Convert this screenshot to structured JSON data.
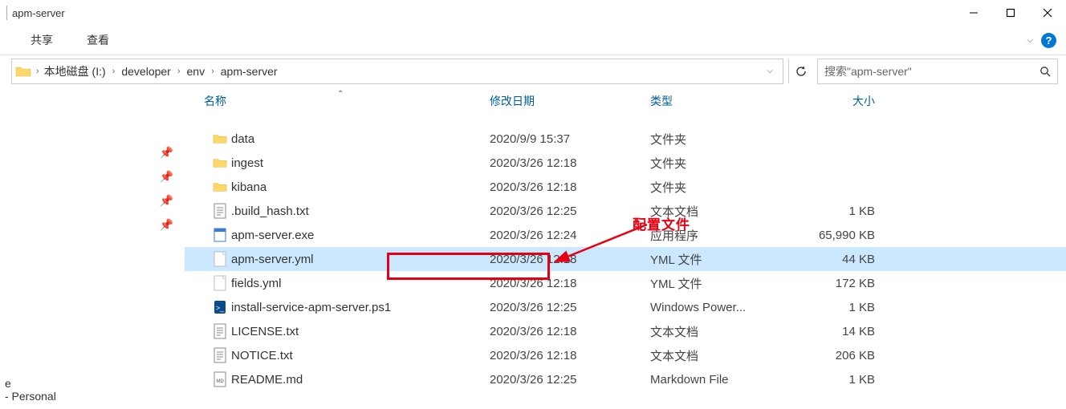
{
  "window": {
    "title": "apm-server"
  },
  "menubar": {
    "share": "共享",
    "view": "查看"
  },
  "breadcrumb": {
    "items": [
      "本地磁盘 (I:)",
      "developer",
      "env",
      "apm-server"
    ]
  },
  "search": {
    "placeholder": "搜索\"apm-server\""
  },
  "columns": {
    "name": "名称",
    "modified": "修改日期",
    "type": "类型",
    "size": "大小"
  },
  "files": [
    {
      "icon": "folder",
      "name": "data",
      "date": "2020/9/9 15:37",
      "type": "文件夹",
      "size": ""
    },
    {
      "icon": "folder",
      "name": "ingest",
      "date": "2020/3/26 12:18",
      "type": "文件夹",
      "size": ""
    },
    {
      "icon": "folder",
      "name": "kibana",
      "date": "2020/3/26 12:18",
      "type": "文件夹",
      "size": ""
    },
    {
      "icon": "txt",
      "name": ".build_hash.txt",
      "date": "2020/3/26 12:25",
      "type": "文本文档",
      "size": "1 KB"
    },
    {
      "icon": "exe",
      "name": "apm-server.exe",
      "date": "2020/3/26 12:24",
      "type": "应用程序",
      "size": "65,990 KB"
    },
    {
      "icon": "yml",
      "name": "apm-server.yml",
      "date": "2020/3/26 12:18",
      "type": "YML 文件",
      "size": "44 KB",
      "selected": true
    },
    {
      "icon": "yml",
      "name": "fields.yml",
      "date": "2020/3/26 12:18",
      "type": "YML 文件",
      "size": "172 KB"
    },
    {
      "icon": "ps1",
      "name": "install-service-apm-server.ps1",
      "date": "2020/3/26 12:25",
      "type": "Windows Power...",
      "size": "1 KB"
    },
    {
      "icon": "txt",
      "name": "LICENSE.txt",
      "date": "2020/3/26 12:18",
      "type": "文本文档",
      "size": "14 KB"
    },
    {
      "icon": "txt",
      "name": "NOTICE.txt",
      "date": "2020/3/26 12:18",
      "type": "文本文档",
      "size": "206 KB"
    },
    {
      "icon": "md",
      "name": "README.md",
      "date": "2020/3/26 12:25",
      "type": "Markdown File",
      "size": "1 KB"
    }
  ],
  "annotation": {
    "label": "配置文件"
  },
  "sidebar": {
    "item_label": "- Personal",
    "item_prefix": "e"
  },
  "pins": [
    1,
    2,
    3,
    4
  ]
}
